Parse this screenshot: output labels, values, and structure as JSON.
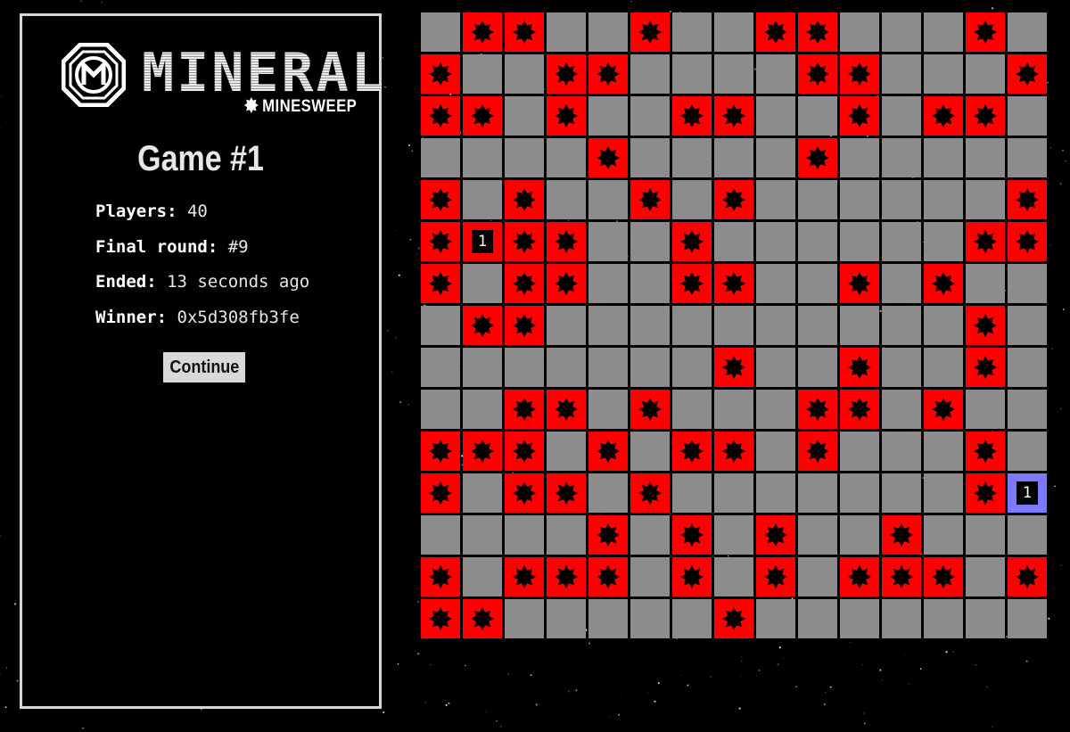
{
  "brand": {
    "name": "MINERAL",
    "subtitle": "MINESWEEP",
    "logo_icon": "octagon-m-logo-icon"
  },
  "game": {
    "title": "Game #1",
    "players_label": "Players:",
    "players_value": "40",
    "final_round_label": "Final round:",
    "final_round_value": "#9",
    "ended_label": "Ended:",
    "ended_value": "13 seconds ago",
    "winner_label": "Winner:",
    "winner_value": "0x5d308fb3fe"
  },
  "actions": {
    "continue_label": "Continue"
  },
  "colors": {
    "mine_cell": "#ff0000",
    "hidden_cell": "#8c8c8c",
    "selected_cell": "#7a7aff",
    "panel_border": "#d6d6d6"
  },
  "board": {
    "rows": 15,
    "cols": 15,
    "legend": {
      ".": "hidden",
      "M": "mine",
      "1": "number 1",
      "S": "selected cell showing 1"
    },
    "grid": [
      ".MM..M..MM...M.",
      "M..MM....MM...M",
      "MM.M..MM..M.MM.",
      "....M....M.....",
      "M.M..M.M......M",
      "M1MM..M......MM",
      "M.MM..MM..M.M..",
      ".MM..........M.",
      ".......M..M..M.",
      "..MM.M...MM.M..",
      "MMM.M.MM.M...M.",
      "M.MM.M.......MS",
      "....M.M.M..M...",
      "M.MMM.M.M.MMM.M",
      "MM.....M......."
    ]
  }
}
